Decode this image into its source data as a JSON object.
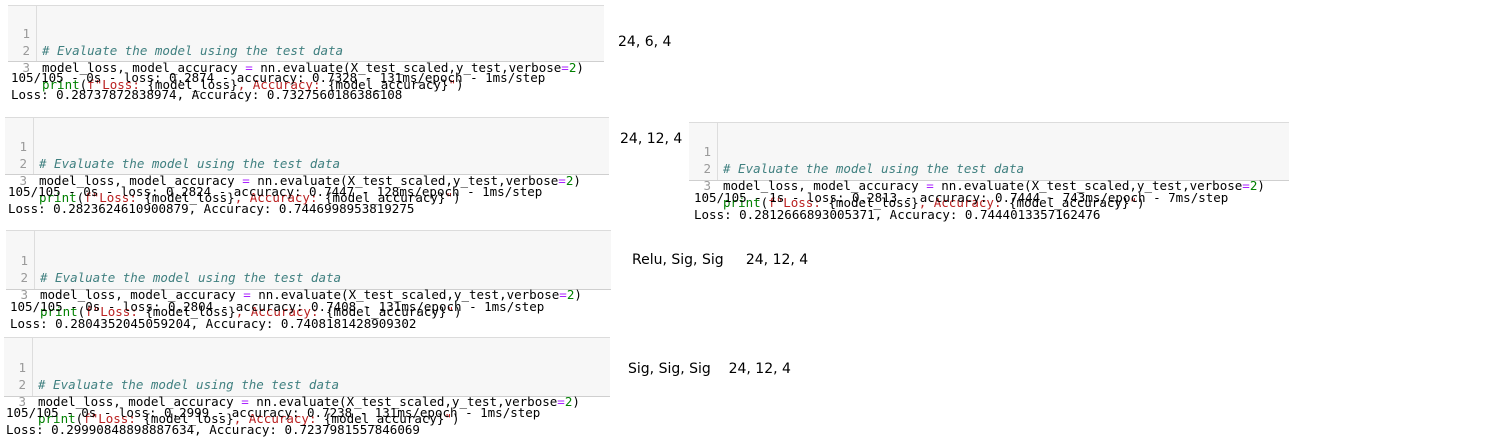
{
  "code": {
    "line_numbers": [
      "1",
      "2",
      "3"
    ],
    "comment": "# Evaluate the model using the test data",
    "l2_a": "model_loss, model_accuracy ",
    "l2_eq": "=",
    "l2_b": " nn.evaluate(X_test_scaled,y_test,verbose",
    "l2_eq2": "=",
    "l2_num": "2",
    "l2_end": ")",
    "l3_kw": "print",
    "l3_a": "(",
    "l3_s1": "f\"Loss: ",
    "l3_v1": "{model_loss}",
    "l3_s2": ", Accuracy: ",
    "l3_v2": "{model_accuracy}",
    "l3_s3": "\"",
    "l3_end": ")"
  },
  "cells": [
    {
      "out1": "105/105 - 0s - loss: 0.2874 - accuracy: 0.7328 - 131ms/epoch - 1ms/step",
      "out2": "Loss: 0.28737872838974, Accuracy: 0.7327560186386108",
      "note": "24, 6, 4"
    },
    {
      "out1": "105/105 - 0s - loss: 0.2824 - accuracy: 0.7447 - 128ms/epoch - 1ms/step",
      "out2": "Loss: 0.2823624610900879, Accuracy: 0.7446998953819275",
      "note": "24, 12, 4"
    },
    {
      "out1": "105/105 - 1s - loss: 0.2813 - accuracy: 0.7444 - 743ms/epoch - 7ms/step",
      "out2": "Loss: 0.2812666893005371, Accuracy: 0.7444013357162476",
      "note": ""
    },
    {
      "out1": "105/105 - 0s - loss: 0.2804 - accuracy: 0.7408 - 131ms/epoch - 1ms/step",
      "out2": "Loss: 0.2804352045059204, Accuracy: 0.7408181428909302",
      "note": "Relu, Sig, Sig     24, 12, 4"
    },
    {
      "out1": "105/105 - 0s - loss: 0.2999 - accuracy: 0.7238 - 131ms/epoch - 1ms/step",
      "out2": "Loss: 0.29990848898887634, Accuracy: 0.7237981557846069",
      "note": "Sig, Sig, Sig    24, 12, 4"
    }
  ]
}
